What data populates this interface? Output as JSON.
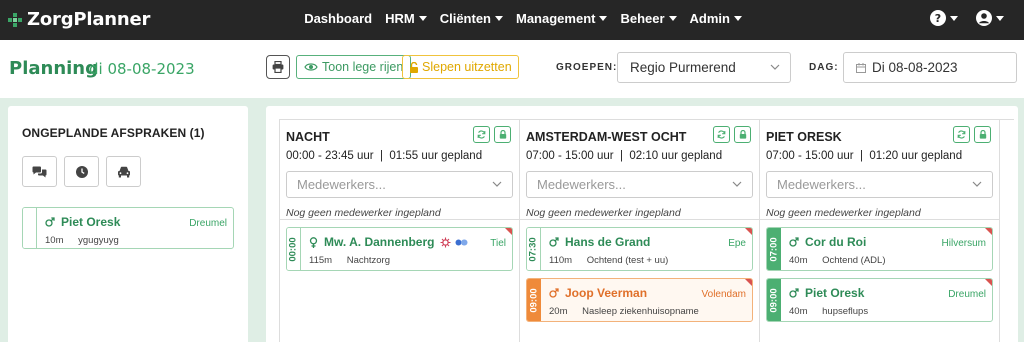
{
  "navbar": {
    "brand": "ZorgPlanner",
    "items": [
      {
        "label": "Dashboard",
        "dropdown": false
      },
      {
        "label": "HRM",
        "dropdown": true
      },
      {
        "label": "Cliënten",
        "dropdown": true
      },
      {
        "label": "Management",
        "dropdown": true
      },
      {
        "label": "Beheer",
        "dropdown": true
      },
      {
        "label": "Admin",
        "dropdown": true
      }
    ]
  },
  "header": {
    "title": "Planning",
    "date": "di 08-08-2023",
    "show_empty_rows": "Toon lege rijen",
    "disable_drag": "Slepen uitzetten",
    "groups_label": "GROEPEN:",
    "groups_value": "Regio Purmerend",
    "day_label": "DAG:",
    "day_value": "Di 08-08-2023"
  },
  "unplanned": {
    "title": "ONGEPLANDE AFSPRAKEN (1)",
    "cards": [
      {
        "name": "Piet Oresk",
        "location": "Dreumel",
        "duration": "10m",
        "description": "ygugyuyg"
      }
    ]
  },
  "columns": [
    {
      "title": "NACHT",
      "hours": "00:00 - 23:45 uur",
      "planned": "01:55 uur gepland",
      "employee_placeholder": "Medewerkers...",
      "no_employee": "Nog geen medewerker ingepland",
      "cards": [
        {
          "time": "00:00",
          "style": "outline",
          "name": "Mw. A. Dannenberg",
          "location": "Tiel",
          "duration": "115m",
          "description": "Nachtzorg",
          "gender": "female",
          "extra_icons": true,
          "flag": true
        }
      ]
    },
    {
      "title": "AMSTERDAM-WEST OCHT",
      "hours": "07:00 - 15:00 uur",
      "planned": "02:10 uur gepland",
      "employee_placeholder": "Medewerkers...",
      "no_employee": "Nog geen medewerker ingepland",
      "cards": [
        {
          "time": "07:30",
          "style": "outline",
          "name": "Hans de Grand",
          "location": "Epe",
          "duration": "110m",
          "description": "Ochtend (test + uu)",
          "gender": "male",
          "extra_icons": false,
          "flag": true
        },
        {
          "time": "09:00",
          "style": "orange",
          "name": "Joop Veerman",
          "location": "Volendam",
          "duration": "20m",
          "description": "Nasleep ziekenhuisopname",
          "gender": "male",
          "extra_icons": false,
          "flag": true
        }
      ]
    },
    {
      "title": "PIET ORESK",
      "hours": "07:00 - 15:00 uur",
      "planned": "01:20 uur gepland",
      "employee_placeholder": "Medewerkers...",
      "no_employee": "Nog geen medewerker ingepland",
      "cards": [
        {
          "time": "07:00",
          "style": "solid",
          "name": "Cor du Roi",
          "location": "Hilversum",
          "duration": "40m",
          "description": "Ochtend (ADL)",
          "gender": "male",
          "extra_icons": false,
          "flag": true
        },
        {
          "time": "09:00",
          "style": "solid",
          "name": "Piet Oresk",
          "location": "Dreumel",
          "duration": "40m",
          "description": "hupseflups",
          "gender": "male",
          "extra_icons": false,
          "flag": true
        }
      ]
    }
  ]
}
